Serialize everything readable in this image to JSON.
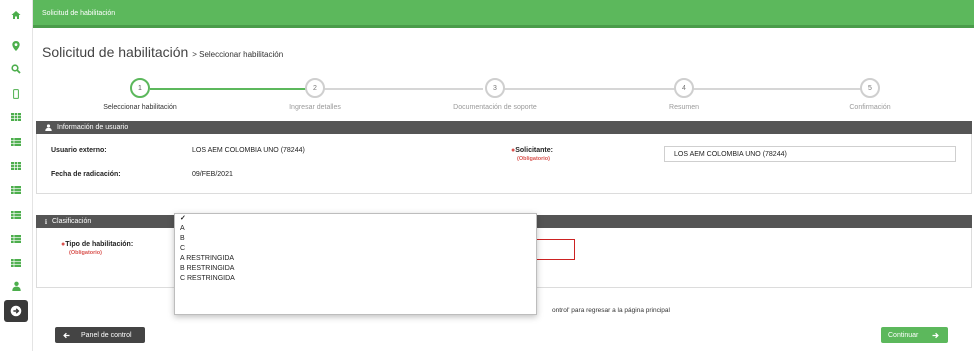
{
  "topbar": {
    "title": "Solicitud de habilitación"
  },
  "sidebar": {
    "icons": [
      "home-icon",
      "map-marker-icon",
      "search-icon",
      "mobile-icon",
      "grid-icon",
      "list-icon",
      "grid-icon",
      "list-icon",
      "list-icon",
      "list-icon",
      "list-icon",
      "user-icon",
      "circle-arrow-right-icon"
    ]
  },
  "page": {
    "title": "Solicitud de habilitación",
    "subtitle": "> Seleccionar habilitación"
  },
  "steps": [
    {
      "number": "1",
      "label": "Seleccionar habilitación",
      "active": true
    },
    {
      "number": "2",
      "label": "Ingresar detalles",
      "active": false
    },
    {
      "number": "3",
      "label": "Documentación de soporte",
      "active": false
    },
    {
      "number": "4",
      "label": "Resumen",
      "active": false
    },
    {
      "number": "5",
      "label": "Confirmación",
      "active": false
    }
  ],
  "user_panel": {
    "header": "Información de usuario",
    "external_user_label": "Usuario externo:",
    "external_user_value": "LOS AEM COLOMBIA UNO (78244)",
    "date_label": "Fecha de radicación:",
    "date_value": "09/FEB/2021",
    "requester_label": "Solicitante:",
    "requester_required": "(Obligatorio)",
    "requester_value": "LOS AEM COLOMBIA UNO (78244)"
  },
  "classification_panel": {
    "header": "Clasificación",
    "type_label": "Tipo de habilitación:",
    "type_required": "(Obligatorio)",
    "options": [
      "",
      "A",
      "B",
      "C",
      "A RESTRINGIDA",
      "B RESTRINGIDA",
      "C RESTRINGIDA"
    ],
    "selected_mark": "✓"
  },
  "hint": "ontrol' para regresar a la página principal",
  "buttons": {
    "control_panel": "Panel de control",
    "continue": "Continuar"
  },
  "colors": {
    "accent": "#5cb85c",
    "dark": "#555555",
    "error": "#d9534f"
  }
}
